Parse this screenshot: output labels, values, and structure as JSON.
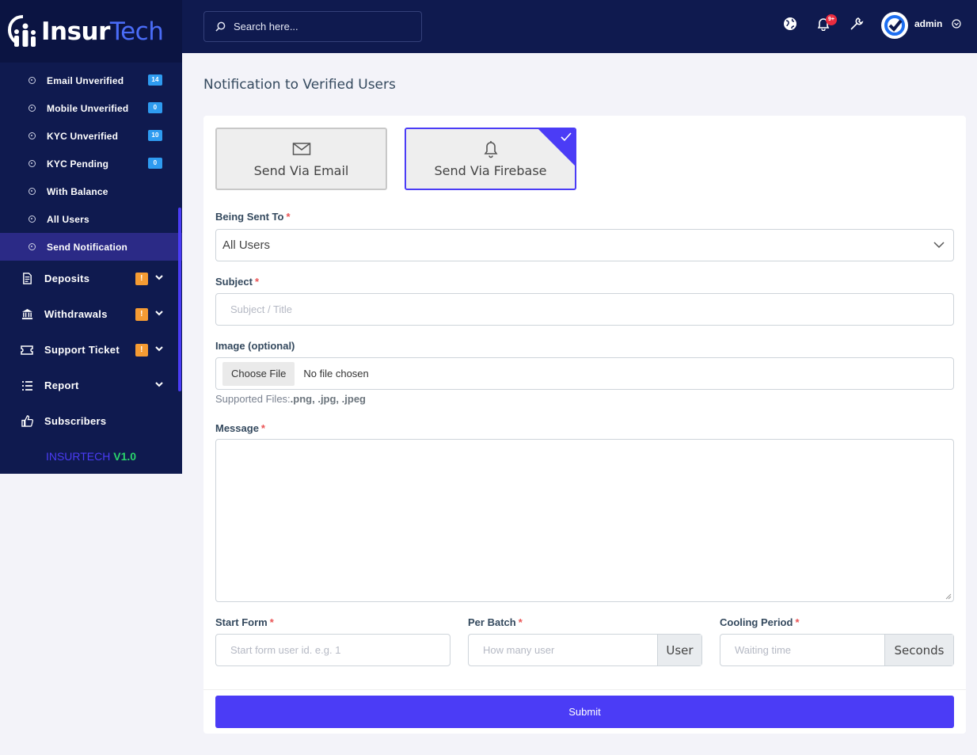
{
  "brand": {
    "name_part1": "Insur",
    "name_part2": "Tech"
  },
  "sidebar": {
    "subitems": [
      {
        "label": "Email Unverified",
        "badge": "14"
      },
      {
        "label": "Mobile Unverified",
        "badge": "0"
      },
      {
        "label": "KYC Unverified",
        "badge": "10"
      },
      {
        "label": "KYC Pending",
        "badge": "0"
      },
      {
        "label": "With Balance"
      },
      {
        "label": "All Users"
      },
      {
        "label": "Send Notification",
        "active": true
      }
    ],
    "items": [
      {
        "label": "Deposits",
        "warn": "!",
        "icon": "deposit-icon"
      },
      {
        "label": "Withdrawals",
        "warn": "!",
        "icon": "bank-icon"
      },
      {
        "label": "Support Ticket",
        "warn": "!",
        "icon": "ticket-icon"
      },
      {
        "label": "Report",
        "icon": "list-icon"
      },
      {
        "label": "Subscribers",
        "icon": "thumbs-up-icon"
      }
    ],
    "version_name": "INSURTECH",
    "version_number": "V1.0"
  },
  "topbar": {
    "search_placeholder": "Search here...",
    "notification_badge": "9+",
    "user_name": "admin"
  },
  "page": {
    "title": "Notification to Verified Users",
    "methods": [
      {
        "label": "Send Via Email",
        "icon": "envelope-icon",
        "selected": false
      },
      {
        "label": "Send Via Firebase",
        "icon": "bell-icon",
        "selected": true
      }
    ],
    "being_sent_to_label": "Being Sent To",
    "being_sent_to_value": "All Users",
    "subject_label": "Subject",
    "subject_placeholder": "Subject / Title",
    "image_label": "Image (optional)",
    "choose_file_label": "Choose File",
    "no_file_text": "No file chosen",
    "supported_prefix": "Supported Files:",
    "supported_types": ".png, .jpg, .jpeg",
    "message_label": "Message",
    "start_form_label": "Start Form",
    "start_form_placeholder": "Start form user id. e.g. 1",
    "per_batch_label": "Per Batch",
    "per_batch_placeholder": "How many user",
    "per_batch_addon": "User",
    "cooling_label": "Cooling Period",
    "cooling_placeholder": "Waiting time",
    "cooling_addon": "Seconds",
    "required_mark": "*",
    "submit_label": "Submit"
  },
  "colors": {
    "sidebar": "#0f1a4f",
    "accent": "#4b3cf6",
    "badge": "#2e9bf0",
    "warning": "#f59b33"
  }
}
